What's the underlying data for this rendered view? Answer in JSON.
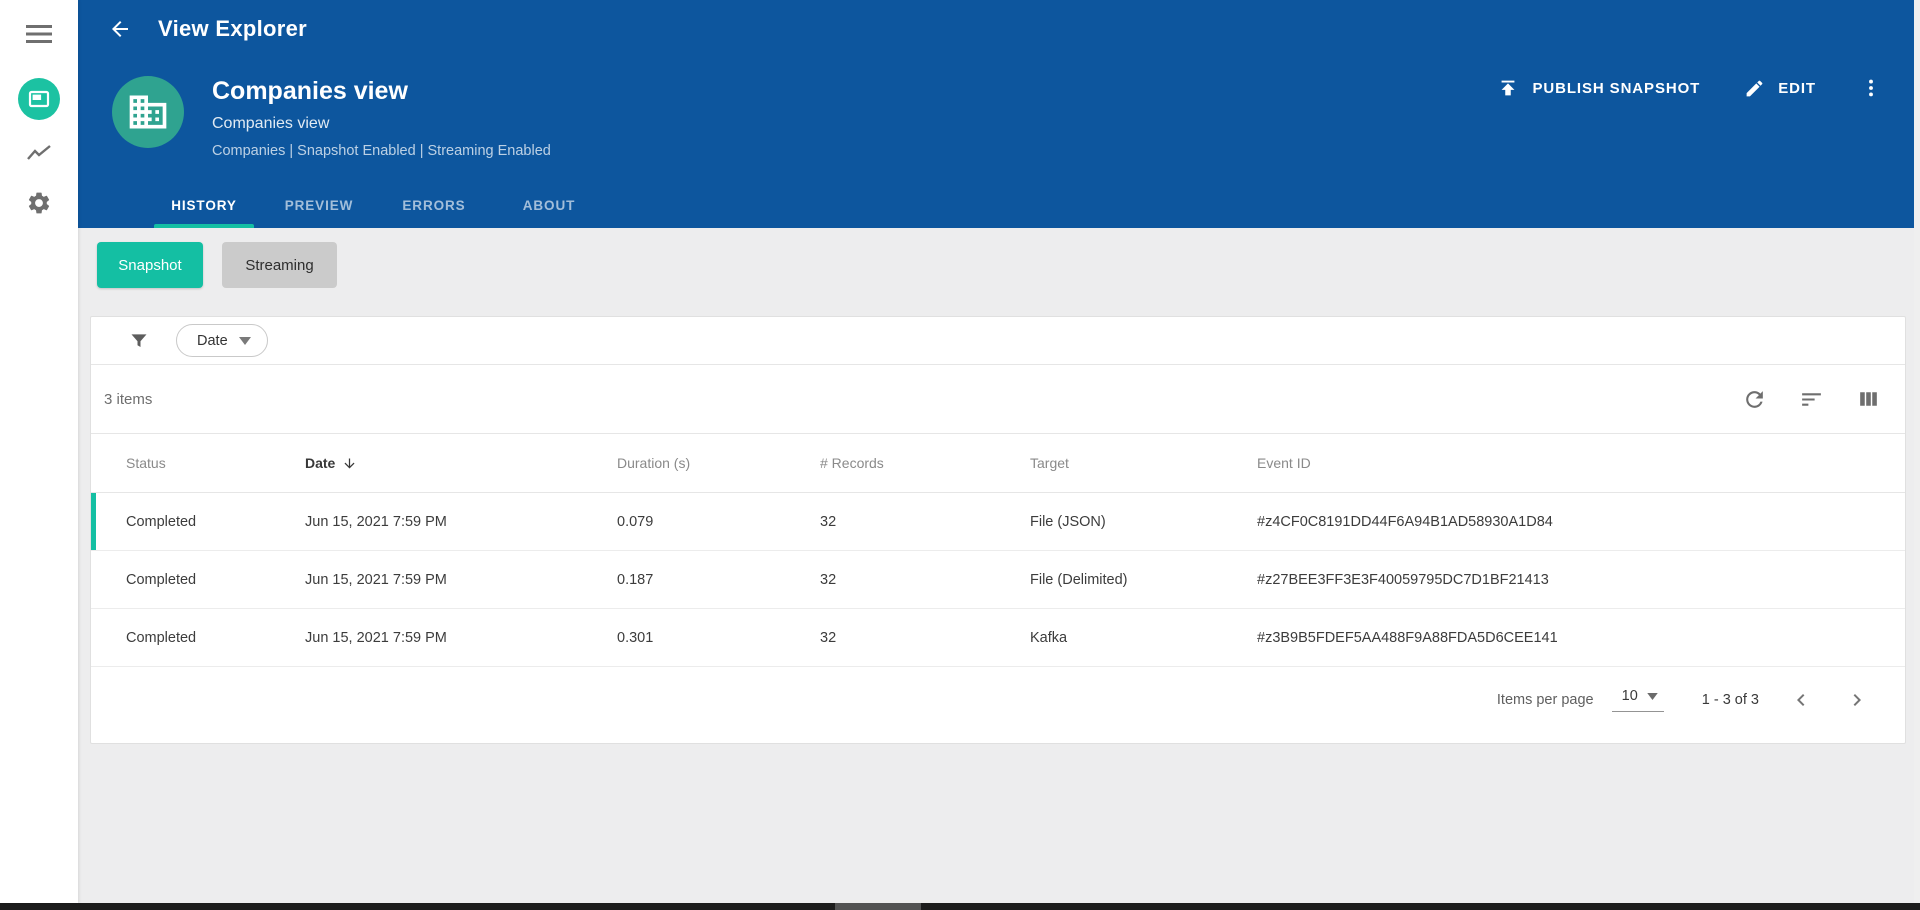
{
  "app": {
    "title": "View Explorer"
  },
  "header": {
    "title": "Companies view",
    "subtitle": "Companies view",
    "meta": "Companies | Snapshot Enabled | Streaming Enabled",
    "actions": {
      "publish_label": "PUBLISH SNAPSHOT",
      "edit_label": "EDIT"
    },
    "tabs": [
      {
        "label": "HISTORY",
        "active": true
      },
      {
        "label": "PREVIEW",
        "active": false
      },
      {
        "label": "ERRORS",
        "active": false
      },
      {
        "label": "ABOUT",
        "active": false
      }
    ]
  },
  "toggle": {
    "snapshot_label": "Snapshot",
    "streaming_label": "Streaming"
  },
  "filter": {
    "chip_label": "Date"
  },
  "table": {
    "items_count": "3 items",
    "columns": {
      "status": "Status",
      "date": "Date",
      "duration": "Duration (s)",
      "records": "# Records",
      "target": "Target",
      "event_id": "Event ID"
    },
    "sort": {
      "column": "Date",
      "direction": "desc"
    },
    "rows": [
      {
        "status": "Completed",
        "date": "Jun 15, 2021 7:59 PM",
        "duration": "0.079",
        "records": "32",
        "target": "File (JSON)",
        "event_id": "#z4CF0C8191DD44F6A94B1AD58930A1D84",
        "selected": true
      },
      {
        "status": "Completed",
        "date": "Jun 15, 2021 7:59 PM",
        "duration": "0.187",
        "records": "32",
        "target": "File (Delimited)",
        "event_id": "#z27BEE3FF3E3F40059795DC7D1BF21413",
        "selected": false
      },
      {
        "status": "Completed",
        "date": "Jun 15, 2021 7:59 PM",
        "duration": "0.301",
        "records": "32",
        "target": "Kafka",
        "event_id": "#z3B9B5FDEF5AA488F9A88FDA5D6CEE141",
        "selected": false
      }
    ],
    "pagination": {
      "items_per_page_label": "Items per page",
      "page_size": "10",
      "range": "1 - 3 of 3"
    }
  },
  "icons": {
    "sidebar": [
      "menu-icon",
      "views-icon",
      "trend-icon",
      "settings-icon"
    ],
    "header": [
      "back-arrow-icon",
      "publish-icon",
      "edit-icon",
      "kebab-menu-icon",
      "building-icon"
    ],
    "table": [
      "filter-funnel-icon",
      "dropdown-caret-icon",
      "refresh-icon",
      "sort-lines-icon",
      "columns-icon",
      "sort-desc-arrow-icon",
      "chevron-left-icon",
      "chevron-right-icon"
    ]
  },
  "colors": {
    "header_blue": "#0d569e",
    "accent_teal": "#14bfa3",
    "rail_circle_teal": "#1cc2a2",
    "avatar_teal": "#2fa390",
    "streaming_gray": "#cbcbcb",
    "content_gray": "#ededee"
  }
}
